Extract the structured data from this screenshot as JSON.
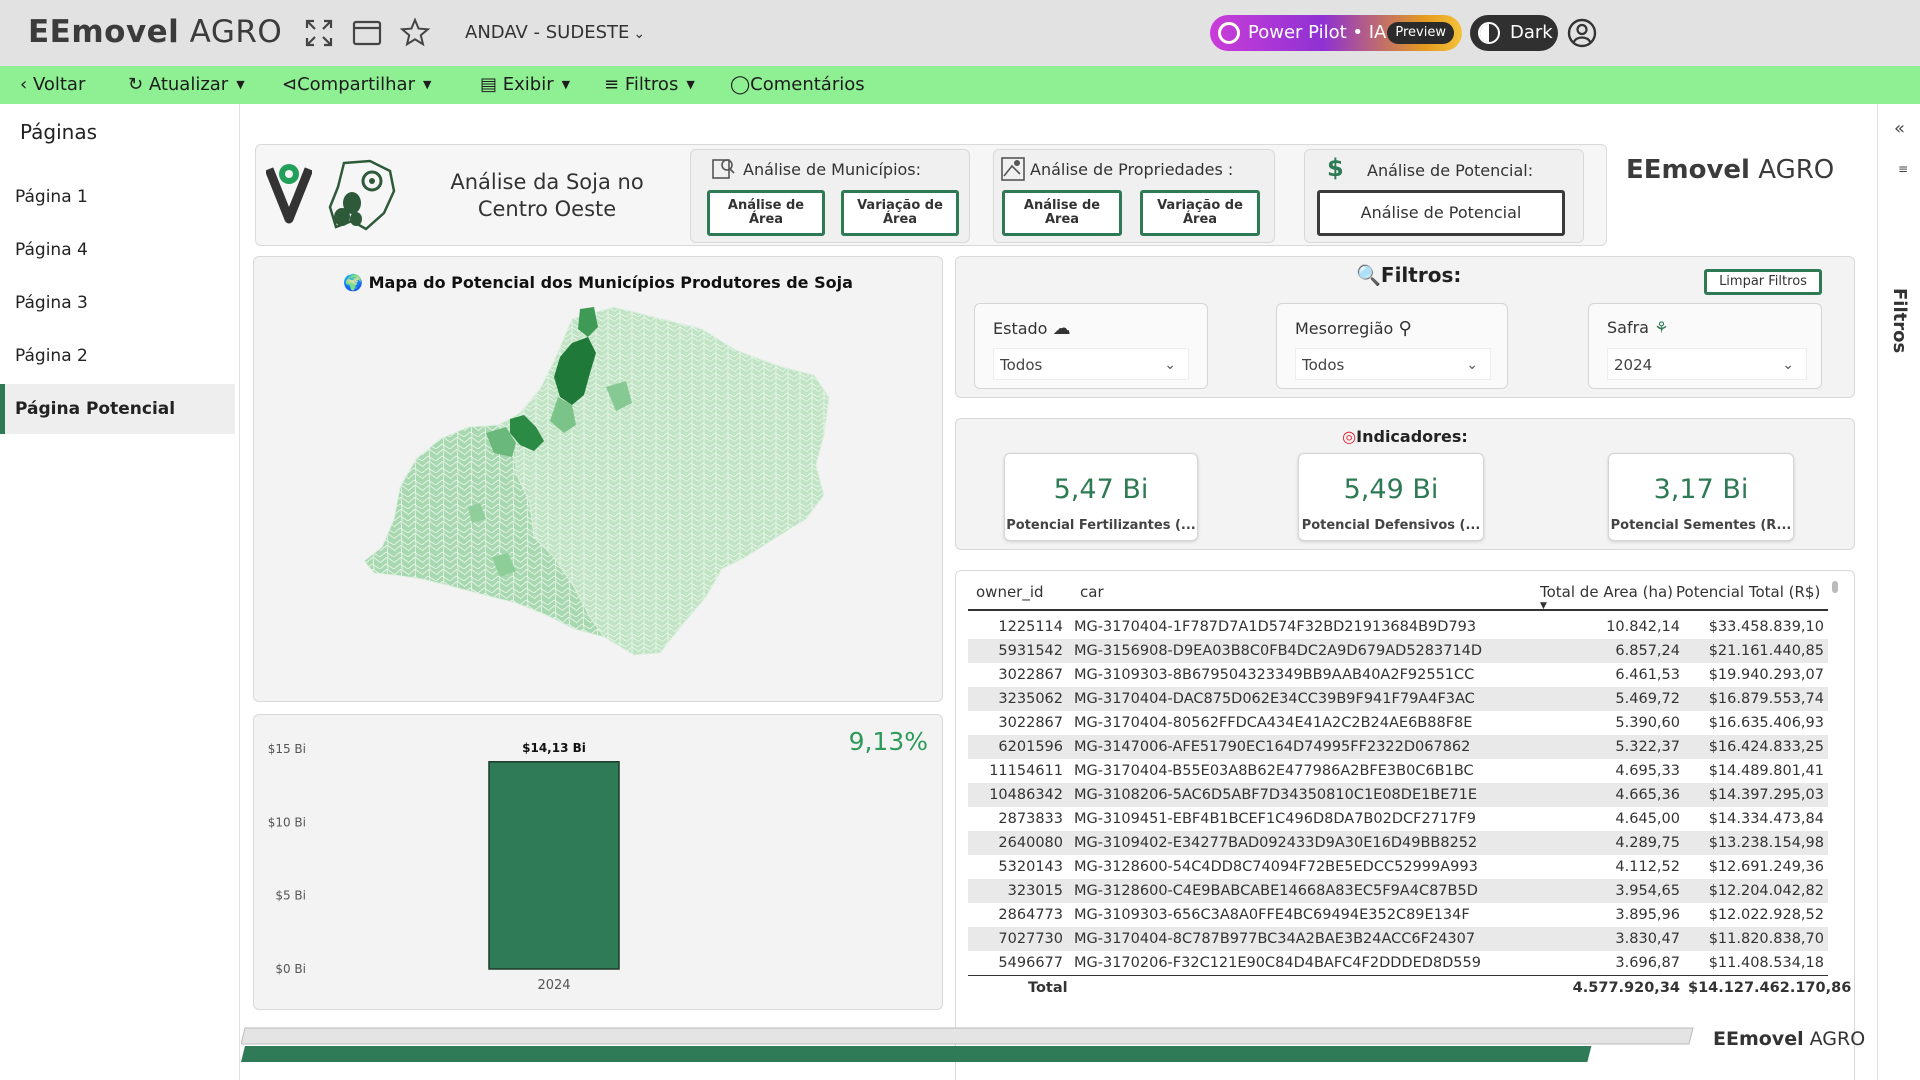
{
  "app": {
    "brand_bold": "EEmovel",
    "brand_light": "AGRO",
    "workspace": "ANDAV - SUDESTE"
  },
  "topbar": {
    "pilot_label": "Power Pilot • IA",
    "pilot_badge": "Preview",
    "theme_label": "Dark"
  },
  "actions": {
    "back": "Voltar",
    "refresh": "Atualizar",
    "share": "Compartilhar",
    "view": "Exibir",
    "filters": "Filtros",
    "comments": "Comentários"
  },
  "sidebar": {
    "title": "Páginas",
    "items": [
      {
        "label": "Página 1"
      },
      {
        "label": "Página 4"
      },
      {
        "label": "Página 3"
      },
      {
        "label": "Página 2"
      },
      {
        "label": "Página Potencial"
      }
    ]
  },
  "right_rail": {
    "label": "Filtros"
  },
  "header": {
    "title": "Análise da Soja no Centro Oeste",
    "municipios": {
      "title": "Análise de Municípios:",
      "btn1": "Análise de Área",
      "btn2": "Variação de Área"
    },
    "propriedades": {
      "title": "Análise de Propriedades :",
      "btn1": "Análise de Area",
      "btn2": "Variação de Área"
    },
    "potencial": {
      "title": "Análise de Potencial:",
      "btn1": "Análise de Potencial"
    },
    "brand_bold": "EEmovel",
    "brand_light": "AGRO"
  },
  "map": {
    "title": "Mapa do Potencial dos Municípios Produtores de Soja"
  },
  "filters": {
    "title": "Filtros:",
    "clear": "Limpar Filtros",
    "estado": {
      "label": "Estado",
      "value": "Todos"
    },
    "mesorregiao": {
      "label": "Mesorregião",
      "value": "Todos"
    },
    "safra": {
      "label": "Safra",
      "value": "2024"
    }
  },
  "indicators": {
    "title": "Indicadores:",
    "items": [
      {
        "value": "5,47 Bi",
        "label": "Potencial Fertilizantes (..."
      },
      {
        "value": "5,49 Bi",
        "label": "Potencial Defensivos (..."
      },
      {
        "value": "3,17 Bi",
        "label": "Potencial Sementes (R..."
      }
    ]
  },
  "chart_data": {
    "type": "bar",
    "categories": [
      "2024"
    ],
    "values": [
      14.13
    ],
    "data_labels": [
      "$14,13 Bi"
    ],
    "y_ticks": [
      "$0 Bi",
      "$5 Bi",
      "$10 Bi",
      "$15 Bi"
    ],
    "ylim": [
      0,
      15
    ],
    "kpi_percent": "9,13%",
    "bar_color": "#2f7b58"
  },
  "table": {
    "columns": [
      "owner_id",
      "car",
      "Total de Area (ha)",
      "Potencial Total (R$)"
    ],
    "rows": [
      [
        "1225114",
        "MG-3170404-1F787D7A1D574F32BD21913684B9D793",
        "10.842,14",
        "$33.458.839,10"
      ],
      [
        "5931542",
        "MG-3156908-D9EA03B8C0FB4DC2A9D679AD5283714D",
        "6.857,24",
        "$21.161.440,85"
      ],
      [
        "3022867",
        "MG-3109303-8B679504323349BB9AAB40A2F92551CC",
        "6.461,53",
        "$19.940.293,07"
      ],
      [
        "3235062",
        "MG-3170404-DAC875D062E34CC39B9F941F79A4F3AC",
        "5.469,72",
        "$16.879.553,74"
      ],
      [
        "3022867",
        "MG-3170404-80562FFDCA434E41A2C2B24AE6B88F8E",
        "5.390,60",
        "$16.635.406,93"
      ],
      [
        "6201596",
        "MG-3147006-AFE51790EC164D74995FF2322D067862",
        "5.322,37",
        "$16.424.833,25"
      ],
      [
        "11154611",
        "MG-3170404-B55E03A8B62E477986A2BFE3B0C6B1BC",
        "4.695,33",
        "$14.489.801,41"
      ],
      [
        "10486342",
        "MG-3108206-5AC6D5ABF7D34350810C1E08DE1BE71E",
        "4.665,36",
        "$14.397.295,03"
      ],
      [
        "2873833",
        "MG-3109451-EBF4B1BCEF1C496D8DA7B02DCF2717F9",
        "4.645,00",
        "$14.334.473,84"
      ],
      [
        "2640080",
        "MG-3109402-E34277BAD092433D9A30E16D49BB8252",
        "4.289,75",
        "$13.238.154,98"
      ],
      [
        "5320143",
        "MG-3128600-54C4DD8C74094F72BE5EDCC52999A993",
        "4.112,52",
        "$12.691.249,36"
      ],
      [
        "323015",
        "MG-3128600-C4E9BABCABE14668A83EC5F9A4C87B5D",
        "3.954,65",
        "$12.204.042,82"
      ],
      [
        "2864773",
        "MG-3109303-656C3A8A0FFE4BC69494E352C89E134F",
        "3.895,96",
        "$12.022.928,52"
      ],
      [
        "7027730",
        "MG-3170404-8C787B977BC34A2BAE3B24ACC6F24307",
        "3.830,47",
        "$11.820.838,70"
      ],
      [
        "5496677",
        "MG-3170206-F32C121E90C84D4BAFC4F2DDDED8D559",
        "3.696,87",
        "$11.408.534,18"
      ]
    ],
    "total_label": "Total",
    "total_area": "4.577.920,34",
    "total_potential": "$14.127.462.170,86"
  },
  "footer": {
    "brand_bold": "EEmovel",
    "brand_light": "AGRO",
    "progress": 0.93
  },
  "colors": {
    "accent": "#2e7a54",
    "action_bar": "#8eef93",
    "topbar": "#e2e2e2"
  }
}
